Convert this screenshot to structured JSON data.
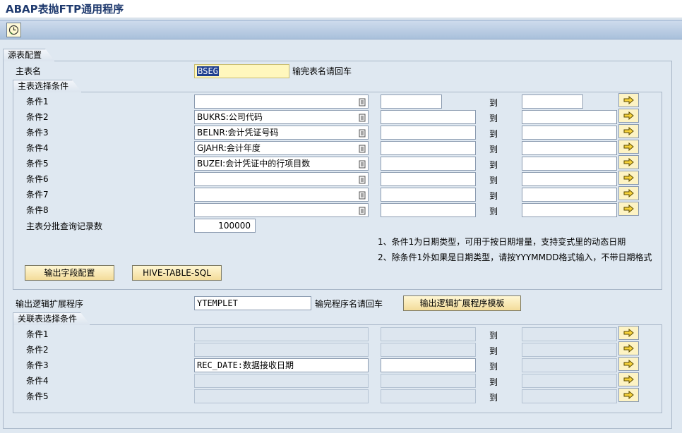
{
  "app": {
    "title": "ABAP表抛FTP通用程序"
  },
  "toolbar": {
    "execute_icon": "execute-clock-icon"
  },
  "source_config": {
    "group_title": "源表配置",
    "main_table_label": "主表名",
    "main_table_value": "BSEG",
    "main_table_hint": "输完表名请回车"
  },
  "main_selection": {
    "group_title": "主表选择条件",
    "to_label": "到",
    "rows": [
      {
        "label": "条件1",
        "field": ""
      },
      {
        "label": "条件2",
        "field": "BUKRS:公司代码"
      },
      {
        "label": "条件3",
        "field": "BELNR:会计凭证号码"
      },
      {
        "label": "条件4",
        "field": "GJAHR:会计年度"
      },
      {
        "label": "条件5",
        "field": "BUZEI:会计凭证中的行项目数"
      },
      {
        "label": "条件6",
        "field": ""
      },
      {
        "label": "条件7",
        "field": ""
      },
      {
        "label": "条件8",
        "field": ""
      }
    ],
    "batch_label": "主表分批查询记录数",
    "batch_value": "100000",
    "note1": "1、条件1为日期类型，可用于按日期增量，支持变式里的动态日期",
    "note2": "2、除条件1外如果是日期类型，请按YYYMMDD格式输入，不带日期格式",
    "btn_output_fields": "输出字段配置",
    "btn_hive_sql": "HIVE-TABLE-SQL"
  },
  "ext_program": {
    "label": "输出逻辑扩展程序",
    "value": "YTEMPLET",
    "hint": "输完程序名请回车",
    "btn_template": "输出逻辑扩展程序模板"
  },
  "join_selection": {
    "group_title": "关联表选择条件",
    "to_label": "到",
    "rows": [
      {
        "label": "条件1",
        "field": ""
      },
      {
        "label": "条件2",
        "field": ""
      },
      {
        "label": "条件3",
        "field": "REC_DATE:数据接收日期"
      },
      {
        "label": "条件4",
        "field": ""
      },
      {
        "label": "条件5",
        "field": ""
      }
    ]
  }
}
